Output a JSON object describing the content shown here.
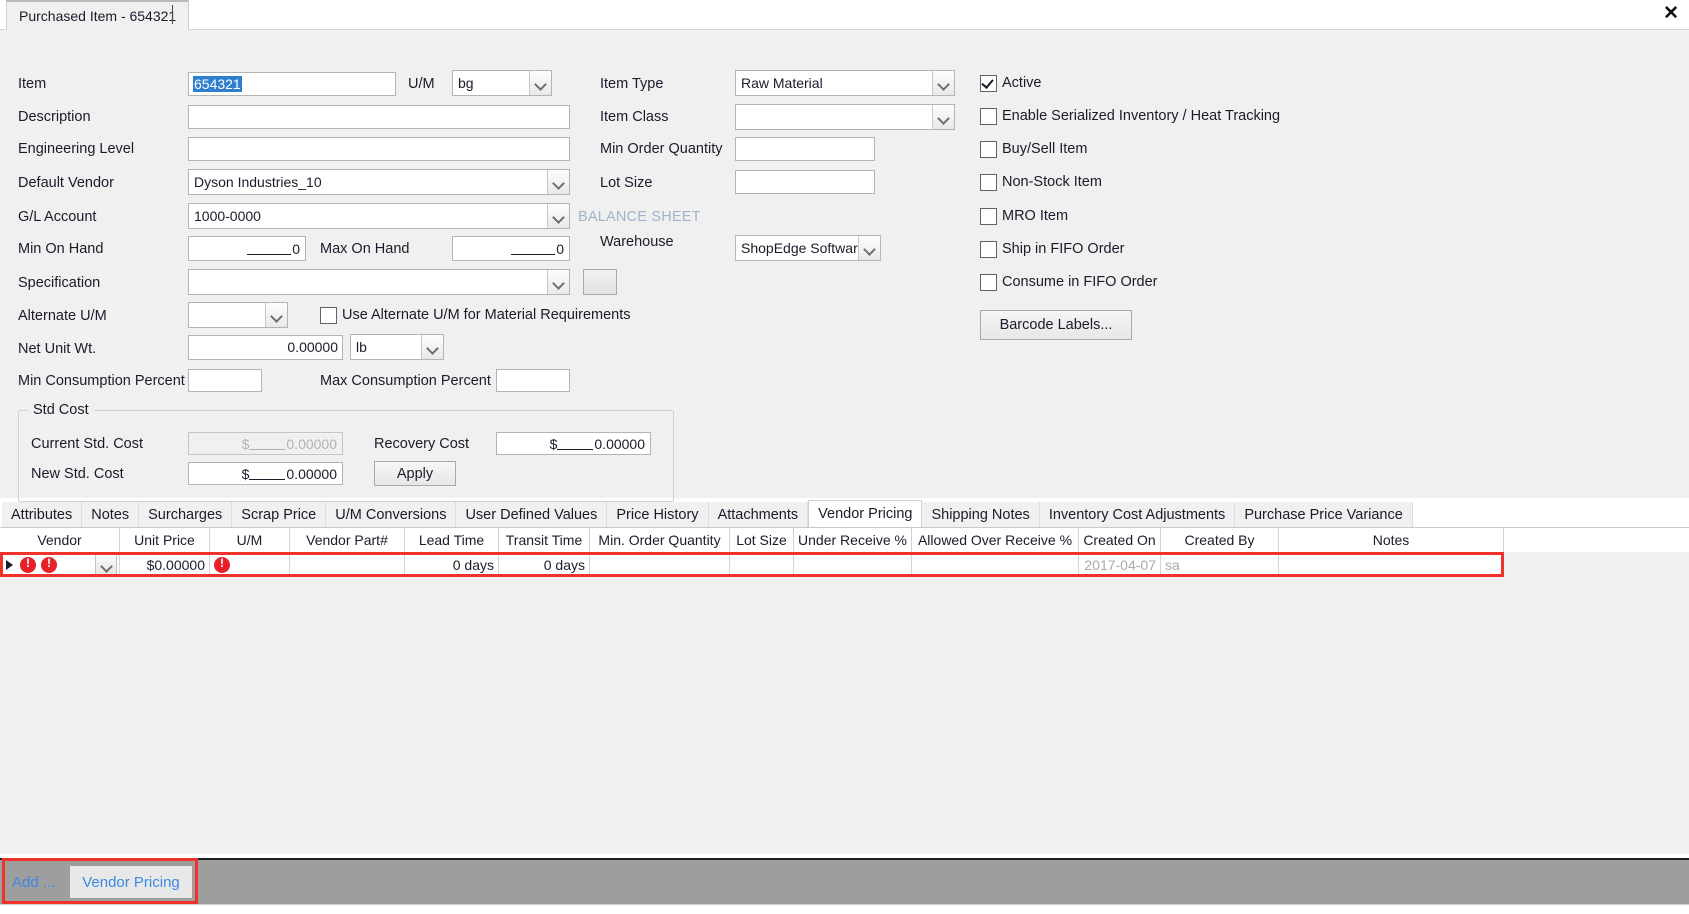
{
  "window": {
    "tab_title": "Purchased Item - 654321",
    "close_icon": "close-icon"
  },
  "form": {
    "labels": {
      "item": "Item",
      "um": "U/M",
      "description": "Description",
      "engineering_level": "Engineering Level",
      "default_vendor": "Default Vendor",
      "gl_account": "G/L Account",
      "min_on_hand": "Min On Hand",
      "max_on_hand": "Max On Hand",
      "specification": "Specification",
      "alternate_um": "Alternate U/M",
      "net_unit_wt": "Net Unit Wt.",
      "min_consumption_percent": "Min Consumption Percent",
      "max_consumption_percent": "Max Consumption Percent",
      "item_type": "Item Type",
      "item_class": "Item Class",
      "min_order_quantity": "Min Order Quantity",
      "lot_size": "Lot Size",
      "balance_sheet": "BALANCE SHEET",
      "warehouse": "Warehouse"
    },
    "values": {
      "item": "654321",
      "um": "bg",
      "description": "",
      "engineering_level": "",
      "default_vendor": "Dyson Industries_10",
      "gl_account": "1000-0000",
      "min_on_hand": "0",
      "max_on_hand": "0",
      "specification": "",
      "alternate_um": "",
      "net_unit_wt": "0.00000",
      "net_unit_wt_um": "lb",
      "min_consumption_percent": "",
      "max_consumption_percent": "",
      "item_type": "Raw Material",
      "item_class": "",
      "min_order_quantity": "",
      "lot_size": "",
      "warehouse": "ShopEdge Software"
    },
    "use_alternate_um_label": "Use Alternate U/M for Material Requirements",
    "checkboxes": [
      {
        "label": "Active",
        "checked": true
      },
      {
        "label": "Enable Serialized Inventory / Heat Tracking",
        "checked": false
      },
      {
        "label": "Buy/Sell Item",
        "checked": false
      },
      {
        "label": "Non-Stock Item",
        "checked": false
      },
      {
        "label": "MRO Item",
        "checked": false
      },
      {
        "label": "Ship in FIFO Order",
        "checked": false
      },
      {
        "label": "Consume in FIFO Order",
        "checked": false
      }
    ],
    "barcode_button": "Barcode Labels..."
  },
  "std_cost": {
    "caption": "Std Cost",
    "current_label": "Current Std. Cost",
    "current_value": "0.00000",
    "new_label": "New Std. Cost",
    "new_value": "0.00000",
    "recovery_label": "Recovery Cost",
    "recovery_value": "0.00000",
    "apply_button": "Apply",
    "currency": "$"
  },
  "tabs": [
    {
      "label": "Attributes",
      "selected": false
    },
    {
      "label": "Notes",
      "selected": false
    },
    {
      "label": "Surcharges",
      "selected": false
    },
    {
      "label": "Scrap Price",
      "selected": false
    },
    {
      "label": "U/M Conversions",
      "selected": false
    },
    {
      "label": "User Defined Values",
      "selected": false
    },
    {
      "label": "Price History",
      "selected": false
    },
    {
      "label": "Attachments",
      "selected": false
    },
    {
      "label": "Vendor Pricing",
      "selected": true
    },
    {
      "label": "Shipping Notes",
      "selected": false
    },
    {
      "label": "Inventory Cost Adjustments",
      "selected": false
    },
    {
      "label": "Purchase Price Variance",
      "selected": false
    }
  ],
  "grid": {
    "columns": [
      "Vendor",
      "Unit Price",
      "U/M",
      "Vendor Part#",
      "Lead Time",
      "Transit Time",
      "Min. Order Quantity",
      "Lot Size",
      "Under Receive %",
      "Allowed Over Receive %",
      "Created On",
      "Created By",
      "Notes"
    ],
    "rows": [
      {
        "selected": true,
        "vendor": "",
        "vendor_error": true,
        "unit_price": "$0.00000",
        "um": "",
        "um_error": true,
        "vendor_part": "",
        "lead_time": "0 days",
        "transit_time": "0 days",
        "min_order_quantity": "",
        "lot_size": "",
        "under_receive_pct": "",
        "allowed_over_receive_pct": "",
        "created_on": "2017-04-07",
        "created_by": "sa",
        "notes": ""
      }
    ]
  },
  "footer": {
    "add_link": "Add ...",
    "active_button": "Vendor Pricing"
  },
  "colors": {
    "accent_highlight": "#f0322c",
    "link": "#3b8ae2",
    "selection": "#2f7fd0",
    "error": "#e8202a",
    "footer_bg": "#9e9e9e",
    "panel_bg": "#f0f0f0"
  }
}
